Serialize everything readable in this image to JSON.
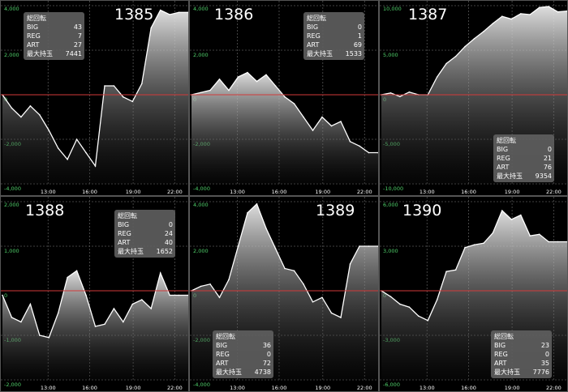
{
  "x_ticks": [
    "13:00",
    "16:00",
    "19:00",
    "22:00"
  ],
  "colors": {
    "zero_line": "#d23a3a",
    "series": "#ffffff",
    "y_labels": "#4fd06a",
    "stats_box": "#5f5f5f"
  },
  "stat_labels": {
    "total": "総回転",
    "big": "BIG",
    "reg": "REG",
    "art": "ART",
    "max": "最大持玉"
  },
  "panels": [
    {
      "number": "1385",
      "stats": {
        "big": "43",
        "reg": "7",
        "art": "27",
        "max": "7441"
      }
    },
    {
      "number": "1386",
      "stats": {
        "big": "0",
        "reg": "1",
        "art": "69",
        "max": "1533"
      }
    },
    {
      "number": "1387",
      "stats": {
        "big": "0",
        "reg": "21",
        "art": "76",
        "max": "9354"
      }
    },
    {
      "number": "1388",
      "stats": {
        "big": "0",
        "reg": "24",
        "art": "40",
        "max": "1652"
      }
    },
    {
      "number": "1389",
      "stats": {
        "big": "36",
        "reg": "0",
        "art": "72",
        "max": "4738"
      }
    },
    {
      "number": "1390",
      "stats": {
        "big": "23",
        "reg": "0",
        "art": "35",
        "max": "7776"
      }
    }
  ],
  "chart_data": [
    {
      "type": "area",
      "title": "1385",
      "ylim": [
        -4000,
        4000
      ],
      "y_tick_labels": [
        "4,000",
        "2,000",
        "0",
        "-2,000",
        "-4,000"
      ],
      "x_tick_labels": [
        "13:00",
        "16:00",
        "19:00",
        "22:00"
      ],
      "x": [
        "10:00",
        "10:40",
        "11:20",
        "12:00",
        "12:40",
        "13:20",
        "14:00",
        "14:40",
        "15:20",
        "16:00",
        "16:40",
        "17:20",
        "18:00",
        "18:40",
        "19:20",
        "20:00",
        "20:40",
        "21:20",
        "22:00",
        "22:40",
        "23:00"
      ],
      "y": [
        0,
        -600,
        -1000,
        -500,
        -900,
        -1600,
        -2400,
        -2900,
        -2000,
        -2600,
        -3200,
        400,
        400,
        -100,
        -300,
        500,
        3000,
        3800,
        3600,
        3700,
        3700
      ]
    },
    {
      "type": "area",
      "title": "1386",
      "ylim": [
        -4000,
        4000
      ],
      "y_tick_labels": [
        "4,000",
        "2,000",
        "0",
        "-2,000",
        "-4,000"
      ],
      "x_tick_labels": [
        "13:00",
        "16:00",
        "19:00",
        "22:00"
      ],
      "x": [
        "10:00",
        "10:40",
        "11:20",
        "12:00",
        "12:40",
        "13:20",
        "14:00",
        "14:40",
        "15:20",
        "16:00",
        "16:40",
        "17:20",
        "18:00",
        "18:40",
        "19:20",
        "20:00",
        "20:40",
        "21:20",
        "22:00",
        "22:40",
        "23:00"
      ],
      "y": [
        0,
        100,
        200,
        700,
        200,
        800,
        1000,
        600,
        900,
        400,
        -100,
        -400,
        -1000,
        -1600,
        -1000,
        -1400,
        -1200,
        -2100,
        -2300,
        -2600,
        -2600
      ]
    },
    {
      "type": "area",
      "title": "1387",
      "ylim": [
        -10000,
        10000
      ],
      "y_tick_labels": [
        "10,000",
        "5,000",
        "0",
        "-5,000",
        "-10,000"
      ],
      "x_tick_labels": [
        "13:00",
        "16:00",
        "19:00",
        "22:00"
      ],
      "x": [
        "10:00",
        "10:40",
        "11:20",
        "12:00",
        "12:40",
        "13:20",
        "14:00",
        "14:40",
        "15:20",
        "16:00",
        "16:40",
        "17:20",
        "18:00",
        "18:40",
        "19:20",
        "20:00",
        "20:40",
        "21:20",
        "22:00",
        "22:40",
        "23:00"
      ],
      "y": [
        0,
        200,
        -200,
        300,
        0,
        0,
        2000,
        3500,
        4300,
        5400,
        6300,
        7100,
        8000,
        8800,
        8500,
        9100,
        9000,
        9800,
        9900,
        9300,
        9400
      ]
    },
    {
      "type": "area",
      "title": "1388",
      "ylim": [
        -2000,
        2000
      ],
      "y_tick_labels": [
        "2,000",
        "1,000",
        "0",
        "-1,000",
        "-2,000"
      ],
      "x_tick_labels": [
        "13:00",
        "16:00",
        "19:00",
        "22:00"
      ],
      "x": [
        "10:00",
        "10:40",
        "11:20",
        "12:00",
        "12:40",
        "13:20",
        "14:00",
        "14:40",
        "15:20",
        "16:00",
        "16:40",
        "17:20",
        "18:00",
        "18:40",
        "19:20",
        "20:00",
        "20:40",
        "21:20",
        "22:00",
        "22:40",
        "23:00"
      ],
      "y": [
        -100,
        -600,
        -700,
        -300,
        -1000,
        -1050,
        -500,
        300,
        450,
        -100,
        -800,
        -750,
        -400,
        -700,
        -300,
        -200,
        -400,
        400,
        -100,
        -100,
        -100
      ]
    },
    {
      "type": "area",
      "title": "1389",
      "ylim": [
        -4000,
        4000
      ],
      "y_tick_labels": [
        "4,000",
        "2,000",
        "0",
        "-2,000",
        "-4,000"
      ],
      "x_tick_labels": [
        "13:00",
        "16:00",
        "19:00",
        "22:00"
      ],
      "x": [
        "10:00",
        "10:40",
        "11:20",
        "12:00",
        "12:40",
        "13:20",
        "14:00",
        "14:40",
        "15:20",
        "16:00",
        "16:40",
        "17:20",
        "18:00",
        "18:40",
        "19:20",
        "20:00",
        "20:40",
        "21:20",
        "22:00",
        "22:40",
        "23:00"
      ],
      "y": [
        0,
        200,
        300,
        -300,
        500,
        2000,
        3500,
        3900,
        2800,
        1900,
        1000,
        900,
        300,
        -500,
        -300,
        -1000,
        -1200,
        1200,
        2000,
        2000,
        2000
      ]
    },
    {
      "type": "area",
      "title": "1390",
      "ylim": [
        -6000,
        6000
      ],
      "y_tick_labels": [
        "6,000",
        "3,000",
        "0",
        "-3,000",
        "-6,000"
      ],
      "x_tick_labels": [
        "13:00",
        "16:00",
        "19:00",
        "22:00"
      ],
      "x": [
        "10:00",
        "10:40",
        "11:20",
        "12:00",
        "12:40",
        "13:20",
        "14:00",
        "14:40",
        "15:20",
        "16:00",
        "16:40",
        "17:20",
        "18:00",
        "18:40",
        "19:20",
        "20:00",
        "20:40",
        "21:20",
        "22:00",
        "22:40",
        "23:00"
      ],
      "y": [
        0,
        -400,
        -900,
        -1100,
        -1700,
        -2000,
        -600,
        1300,
        1400,
        2900,
        3100,
        3200,
        3900,
        5400,
        4800,
        5100,
        3700,
        3800,
        3300,
        3300,
        3300
      ]
    }
  ]
}
